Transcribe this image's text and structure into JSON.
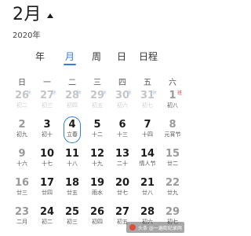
{
  "header": {
    "month": "2月",
    "year": "2020年"
  },
  "tabs": [
    {
      "label": "年",
      "active": false
    },
    {
      "label": "月",
      "active": true
    },
    {
      "label": "周",
      "active": false
    },
    {
      "label": "日",
      "active": false
    },
    {
      "label": "日程",
      "active": false
    }
  ],
  "weekdays": [
    "日",
    "一",
    "二",
    "三",
    "四",
    "五",
    "六"
  ],
  "weeks": [
    [
      {
        "num": "26",
        "lunar": "初二",
        "badge": "休",
        "other": true
      },
      {
        "num": "27",
        "lunar": "初三",
        "badge": "休",
        "other": true
      },
      {
        "num": "28",
        "lunar": "初四",
        "badge": "休",
        "other": true
      },
      {
        "num": "29",
        "lunar": "初五",
        "badge": "休",
        "other": true
      },
      {
        "num": "30",
        "lunar": "初六",
        "badge": "休",
        "other": true
      },
      {
        "num": "31",
        "lunar": "初七",
        "badge": "休",
        "other": true
      },
      {
        "num": "1",
        "lunar": "初八",
        "badge": "班",
        "work": true,
        "weekend": true
      }
    ],
    [
      {
        "num": "2",
        "lunar": "初九",
        "weekend": true
      },
      {
        "num": "3",
        "lunar": "初十"
      },
      {
        "num": "4",
        "lunar": "立春",
        "today": true
      },
      {
        "num": "5",
        "lunar": "十二"
      },
      {
        "num": "6",
        "lunar": "十三"
      },
      {
        "num": "7",
        "lunar": "十四"
      },
      {
        "num": "8",
        "lunar": "元宵节",
        "weekend": true
      }
    ],
    [
      {
        "num": "9",
        "lunar": "十六",
        "weekend": true
      },
      {
        "num": "10",
        "lunar": "十七"
      },
      {
        "num": "11",
        "lunar": "十八"
      },
      {
        "num": "12",
        "lunar": "十九"
      },
      {
        "num": "13",
        "lunar": "二十"
      },
      {
        "num": "14",
        "lunar": "情人节"
      },
      {
        "num": "15",
        "lunar": "廿二",
        "weekend": true
      }
    ],
    [
      {
        "num": "16",
        "lunar": "廿三",
        "weekend": true
      },
      {
        "num": "17",
        "lunar": "廿四"
      },
      {
        "num": "18",
        "lunar": "廿五"
      },
      {
        "num": "19",
        "lunar": "雨水"
      },
      {
        "num": "20",
        "lunar": "廿七"
      },
      {
        "num": "21",
        "lunar": "廿八"
      },
      {
        "num": "22",
        "lunar": "廿九",
        "weekend": true
      }
    ],
    [
      {
        "num": "23",
        "lunar": "二月",
        "weekend": true
      },
      {
        "num": "24",
        "lunar": "初二"
      },
      {
        "num": "25",
        "lunar": "初三"
      },
      {
        "num": "26",
        "lunar": "初四"
      },
      {
        "num": "27",
        "lunar": "初五"
      },
      {
        "num": "28",
        "lunar": "初六"
      },
      {
        "num": "29",
        "lunar": "初七",
        "weekend": true
      }
    ]
  ],
  "watermark": "头条 @一遍街纪录网",
  "colors": {
    "accent": "#2f80d9",
    "workday": "#d94040"
  }
}
